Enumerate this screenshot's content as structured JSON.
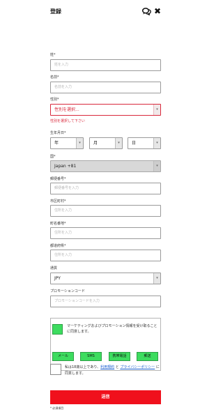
{
  "header": {
    "title": "登録",
    "chat_icon": "chat-bubbles-icon",
    "close_icon": "close-icon"
  },
  "fields": {
    "last_name": {
      "label": "姓*",
      "placeholder": "姓を入力"
    },
    "first_name": {
      "label": "名前*",
      "placeholder": "名前を入力"
    },
    "gender": {
      "label": "性別*",
      "value": "性別を選択...",
      "error": "性別を選択して下さい"
    },
    "birthdate": {
      "label": "生年月日*",
      "year": "年",
      "month": "月",
      "day": "日"
    },
    "country": {
      "label": "国*",
      "value": "Japan +81"
    },
    "postal_code": {
      "label": "郵便番号*",
      "placeholder": "郵便番号を入力"
    },
    "city": {
      "label": "市区町村*",
      "placeholder": "住所を入力"
    },
    "street": {
      "label": "町名番地*",
      "placeholder": "住所を入力"
    },
    "prefecture": {
      "label": "都道府県*",
      "placeholder": "住所を入力"
    },
    "currency": {
      "label": "通貨",
      "value": "JPY"
    },
    "promo": {
      "label": "プロモーションコード",
      "placeholder": "プロモーションコードを入力"
    }
  },
  "marketing": {
    "text": "マーケティングおよびプロモーション情報を受け取ることに同意します。",
    "channels": [
      "メール",
      "SMS",
      "携帯電話",
      "郵送"
    ]
  },
  "age_confirm": {
    "prefix": "私は18歳以上であり、",
    "terms_link": "利用規約",
    "middle": " と ",
    "privacy_link": "プライバシーポリシー",
    "suffix": " に同意します。"
  },
  "submit_label": "送信",
  "required_note": "* 必須項目",
  "colors": {
    "accent_red": "#f0101c",
    "error_red": "#d9283b",
    "consent_green": "#3ddc5f",
    "link_blue": "#1a5fd0"
  }
}
